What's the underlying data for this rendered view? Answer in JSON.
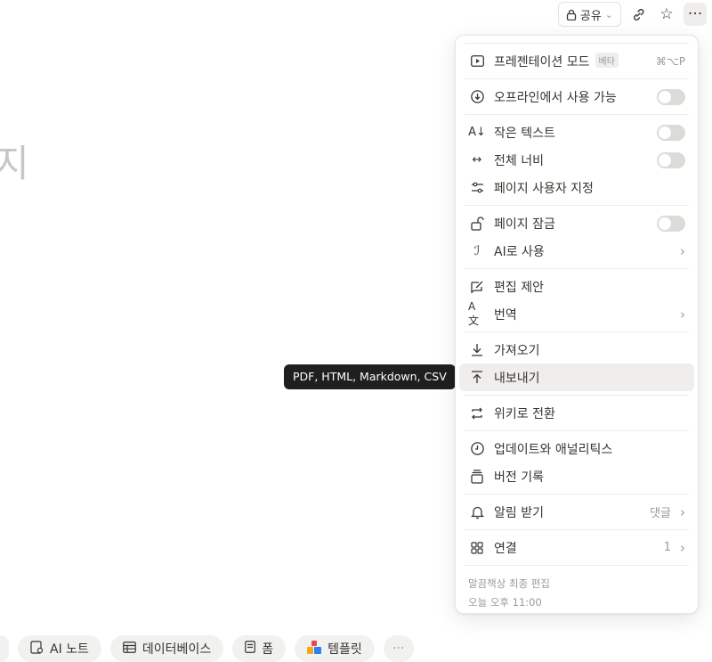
{
  "topbar": {
    "share_label": "공유",
    "share_chevron": "⌄",
    "link_icon": "link-icon",
    "star_icon": "star-icon",
    "more_icon": "more-icon"
  },
  "page": {
    "big_char": "지"
  },
  "tooltip": {
    "text": "PDF, HTML, Markdown, CSV"
  },
  "menu": {
    "presentation": {
      "label": "프레젠테이션 모드",
      "badge": "베타",
      "shortcut": "⌘⌥P"
    },
    "offline": {
      "label": "오프라인에서 사용 가능"
    },
    "small_text": {
      "label": "작은 텍스트"
    },
    "full_width": {
      "label": "전체 너비"
    },
    "customize": {
      "label": "페이지 사용자 지정"
    },
    "lock": {
      "label": "페이지 잠금"
    },
    "ai": {
      "label": "AI로 사용"
    },
    "suggest": {
      "label": "편집 제안"
    },
    "translate": {
      "label": "번역"
    },
    "import": {
      "label": "가져오기"
    },
    "export": {
      "label": "내보내기"
    },
    "wiki": {
      "label": "위키로 전환"
    },
    "updates": {
      "label": "업데이트와 애널리틱스"
    },
    "history": {
      "label": "버전 기록"
    },
    "notify": {
      "label": "알림 받기",
      "value": "댓글"
    },
    "connect": {
      "label": "연결",
      "value": "1"
    },
    "footer": {
      "editor": "말끔책상 최종 편집",
      "time": "오늘 오후 11:00"
    }
  },
  "bottombar": {
    "ai_note": "AI 노트",
    "database": "데이터베이스",
    "form": "폼",
    "template": "템플릿",
    "more": "···"
  },
  "colors": {
    "accent": "#37352f",
    "tooltip_bg": "#1f1f1f",
    "hover_bg": "#efeeec"
  }
}
